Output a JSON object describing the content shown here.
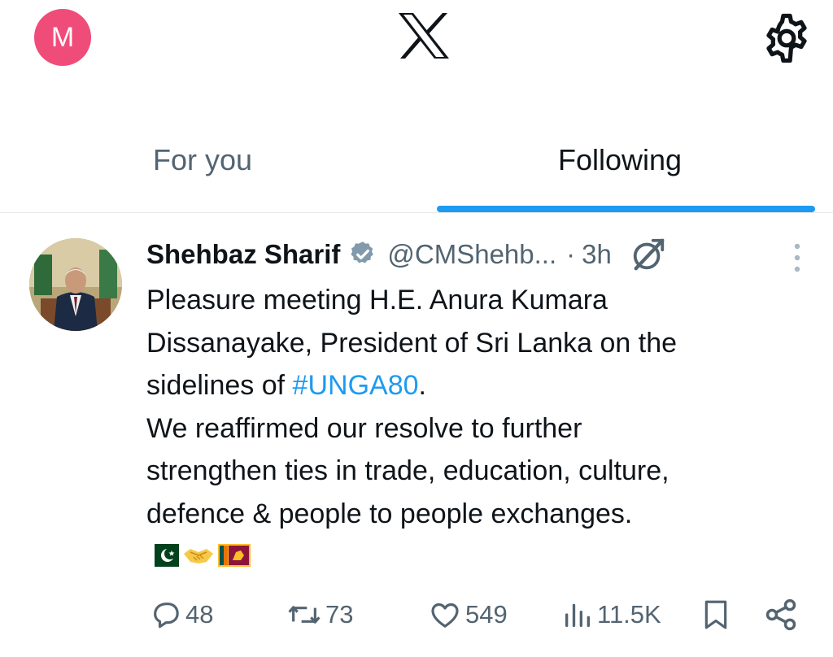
{
  "header": {
    "account_initial": "M",
    "logo_icon": "x-logo-icon",
    "settings_icon": "gear-icon"
  },
  "tabs": [
    {
      "label": "For you",
      "active": false
    },
    {
      "label": "Following",
      "active": true
    }
  ],
  "tweet": {
    "display_name": "Shehbaz Sharif",
    "handle": "@CMShehb...",
    "separator": "·",
    "time": "3h",
    "text": {
      "line1": "Pleasure meeting H.E. Anura Kumara",
      "line2": "Dissanayake, President of Sri Lanka on the",
      "line3_pre": "sidelines of ",
      "hashtag": "#UNGA80",
      "line3_post": ".",
      "line4": "We reaffirmed our resolve to further",
      "line5": "strengthen ties in trade, education, culture,",
      "line6": "defence & people to people exchanges."
    },
    "emojis": [
      "pakistan-flag-icon",
      "handshake-icon",
      "sri-lanka-flag-icon"
    ],
    "stats": {
      "replies": "48",
      "retweets": "73",
      "likes": "549",
      "views": "11.5K"
    }
  },
  "colors": {
    "accent": "#1d9bf0",
    "avatar": "#f04c79",
    "secondary_text": "#536471"
  }
}
